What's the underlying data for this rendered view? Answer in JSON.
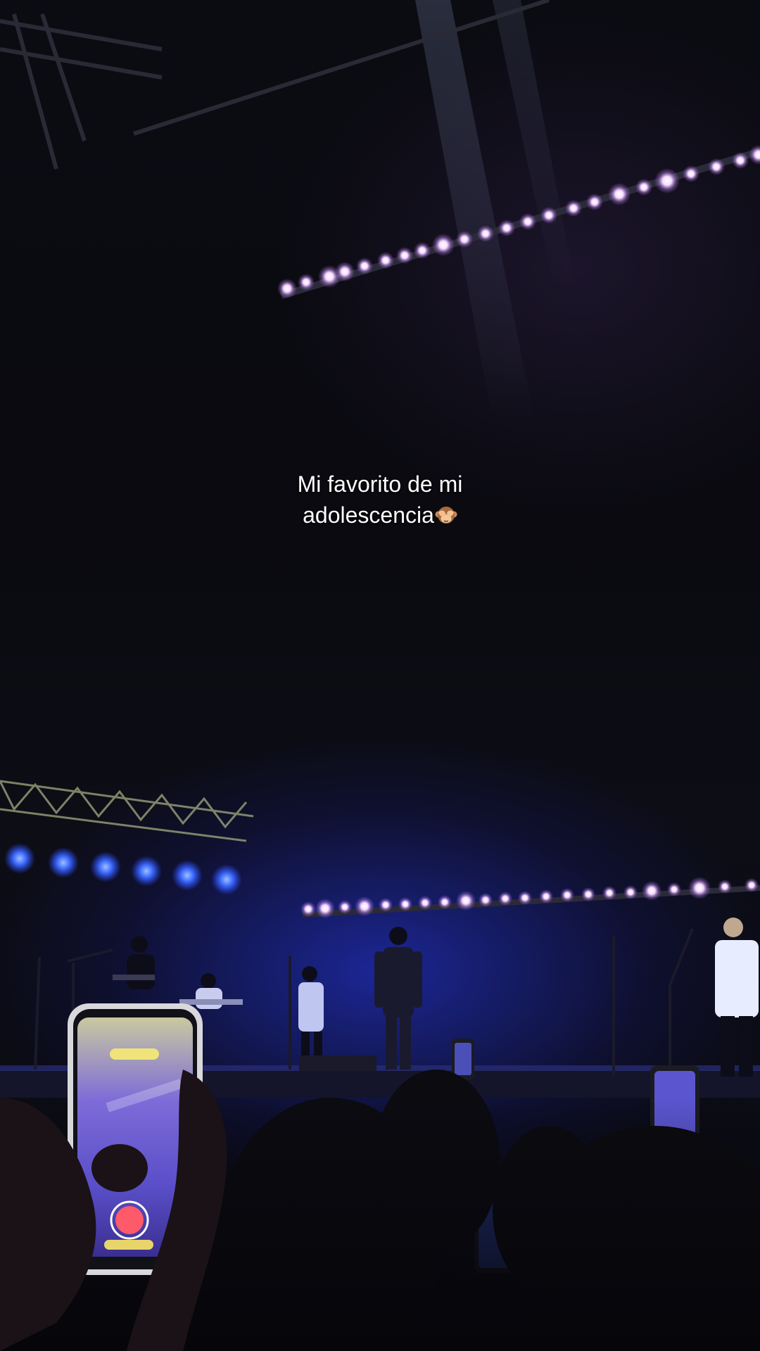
{
  "caption": {
    "line1": "Mi favorito de mi",
    "line2": "adolescencia",
    "emoji": "see-no-evil-monkey"
  },
  "colors": {
    "stage_light": "#3a4dff",
    "bulb_pink": "#f3d6ff",
    "caption_text": "#ffffff"
  }
}
